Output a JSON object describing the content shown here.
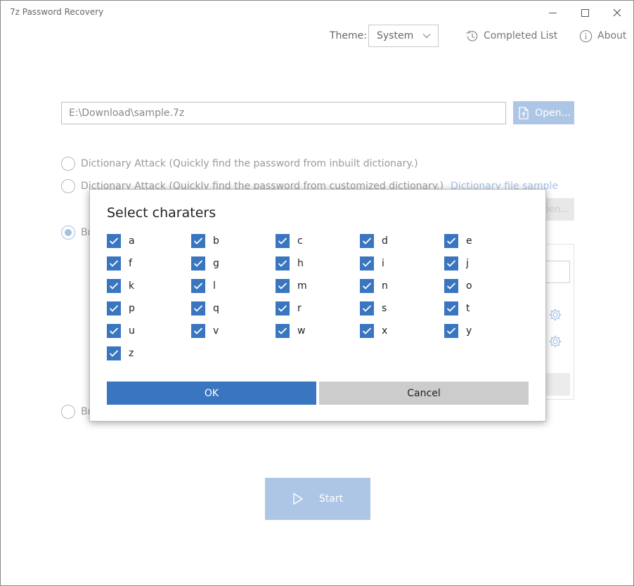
{
  "window": {
    "title": "7z Password Recovery"
  },
  "header": {
    "theme_label": "Theme:",
    "theme_value": "System",
    "completed_list": "Completed List",
    "about": "About"
  },
  "file": {
    "path": "E:\\Download\\sample.7z",
    "open_label": "Open..."
  },
  "attacks": {
    "dict_inbuilt": "Dictionary Attack (Quickly find the password from inbuilt dictionary.)",
    "dict_custom": "Dictionary Attack (Quickly find the password from customized dictionary.)",
    "dict_sample_link": "Dictionary file sample",
    "brute1_partial": "Br",
    "brute2_partial": "Br",
    "open2_partial": "pen..."
  },
  "start_label": "Start",
  "dialog": {
    "title": "Select charaters",
    "chars": [
      "a",
      "b",
      "c",
      "d",
      "e",
      "f",
      "g",
      "h",
      "i",
      "j",
      "k",
      "l",
      "m",
      "n",
      "o",
      "p",
      "q",
      "r",
      "s",
      "t",
      "u",
      "v",
      "w",
      "x",
      "y",
      "z"
    ],
    "ok_label": "OK",
    "cancel_label": "Cancel"
  },
  "colors": {
    "accent": "#3a76c0",
    "accent_disabled": "#aec6e6",
    "cancel_bg": "#cccccc"
  }
}
